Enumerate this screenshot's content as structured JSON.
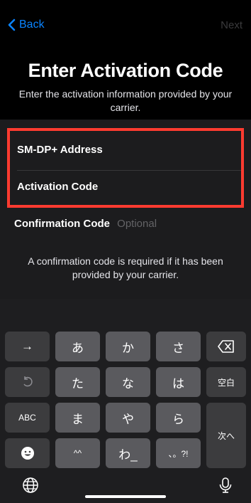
{
  "nav": {
    "back_label": "Back",
    "next_label": "Next"
  },
  "header": {
    "title": "Enter Activation Code",
    "subtitle": "Enter the activation information provided by your carrier."
  },
  "form": {
    "smdp_label": "SM-DP+ Address",
    "activation_label": "Activation Code",
    "confirmation_label": "Confirmation Code",
    "confirmation_placeholder": "Optional"
  },
  "note": "A confirmation code is required if it has been provided by your carrier.",
  "keyboard": {
    "row1": [
      "→",
      "あ",
      "か",
      "さ"
    ],
    "row2": [
      "た",
      "な",
      "は"
    ],
    "space_label": "空白",
    "abc_label": "ABC",
    "row3": [
      "ま",
      "や",
      "ら"
    ],
    "next_line_label": "次へ",
    "row4": [
      "^^",
      "わ_",
      "、。?!"
    ]
  },
  "colors": {
    "accent": "#0a84ff",
    "highlight": "#ff3b30"
  },
  "icons": [
    "chevron-left-icon",
    "backspace-icon",
    "undo-icon",
    "emoji-icon",
    "globe-icon",
    "microphone-icon"
  ]
}
